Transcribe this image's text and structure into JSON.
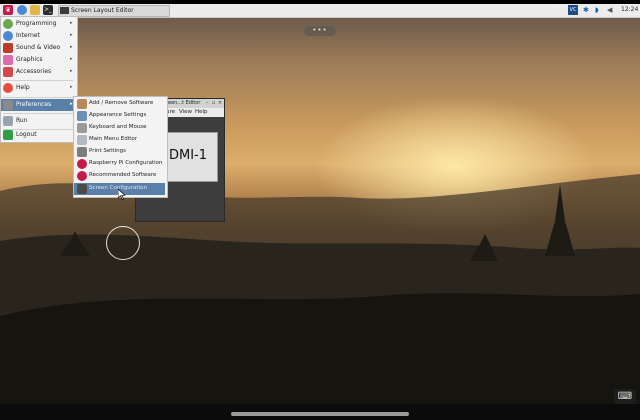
{
  "taskbar": {
    "active_window": "Screen Layout Editor",
    "clock": "12:24",
    "tray_badge": "VC"
  },
  "main_menu": {
    "items": [
      {
        "label": "Programming",
        "icon": "programming-icon",
        "has_submenu": true
      },
      {
        "label": "Internet",
        "icon": "globe-icon",
        "has_submenu": true
      },
      {
        "label": "Sound & Video",
        "icon": "sound-video-icon",
        "has_submenu": true
      },
      {
        "label": "Graphics",
        "icon": "graphics-icon",
        "has_submenu": true
      },
      {
        "label": "Accessories",
        "icon": "accessories-icon",
        "has_submenu": true
      },
      {
        "label": "Help",
        "icon": "help-icon",
        "has_submenu": true
      },
      {
        "label": "Preferences",
        "icon": "preferences-icon",
        "has_submenu": true,
        "selected": true
      },
      {
        "label": "Run",
        "icon": "run-icon",
        "has_submenu": false
      },
      {
        "label": "Logout",
        "icon": "logout-icon",
        "has_submenu": false
      }
    ],
    "arrow": "▸"
  },
  "preferences_menu": {
    "items": [
      {
        "label": "Add / Remove Software",
        "icon": "package-icon"
      },
      {
        "label": "Appearance Settings",
        "icon": "appearance-icon"
      },
      {
        "label": "Keyboard and Mouse",
        "icon": "keyboard-icon"
      },
      {
        "label": "Main Menu Editor",
        "icon": "menu-editor-icon"
      },
      {
        "label": "Print Settings",
        "icon": "printer-icon"
      },
      {
        "label": "Raspberry Pi Configuration",
        "icon": "raspberry-icon"
      },
      {
        "label": "Recommended Software",
        "icon": "raspberry-icon"
      },
      {
        "label": "Screen Configuration",
        "icon": "display-icon",
        "selected": true
      }
    ]
  },
  "editor": {
    "title": "reen...t Editor",
    "menu": [
      "ure",
      "View",
      "Help"
    ],
    "monitor_label": "DMI-1"
  },
  "colors": {
    "menu_highlight": "#5a7fa8",
    "menu_bg": "#f3f3f3",
    "taskbar_bg": "#ececec"
  }
}
